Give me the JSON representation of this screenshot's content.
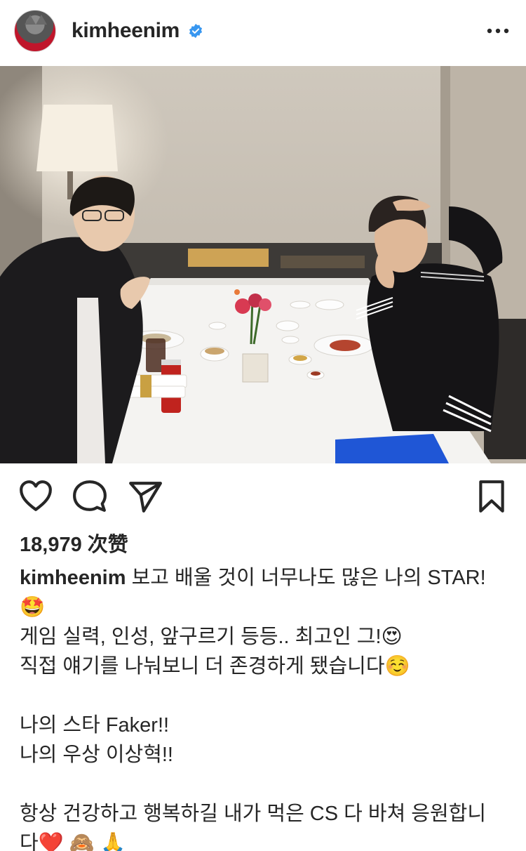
{
  "post": {
    "username": "kimheenim",
    "verified": true,
    "likes_text": "18,979 次赞",
    "caption": {
      "line1": "보고 배울 것이 너무나도 많은 나의 STAR!",
      "line2_emoji": "🤩",
      "line3": "게임 실력, 인성, 앞구르기 등등.. 최고인 그!😍",
      "line4": "직접 얘기를 나눠보니 더 존경하게 됐습니다☺️",
      "line5": "나의 스타 Faker!!",
      "line6": "나의 우상 이상혁!!",
      "line7": "항상 건강하고 행복하길 내가 먹은 CS 다 바쳐 응원합니",
      "line8": "다❤️ 🙈 🙏"
    }
  },
  "icons": {
    "verified": "verified-badge-icon",
    "more": "more-options-icon",
    "like": "heart-icon",
    "comment": "comment-icon",
    "share": "send-icon",
    "save": "bookmark-icon"
  },
  "colors": {
    "verified_blue": "#3897f0",
    "text": "#262626"
  }
}
